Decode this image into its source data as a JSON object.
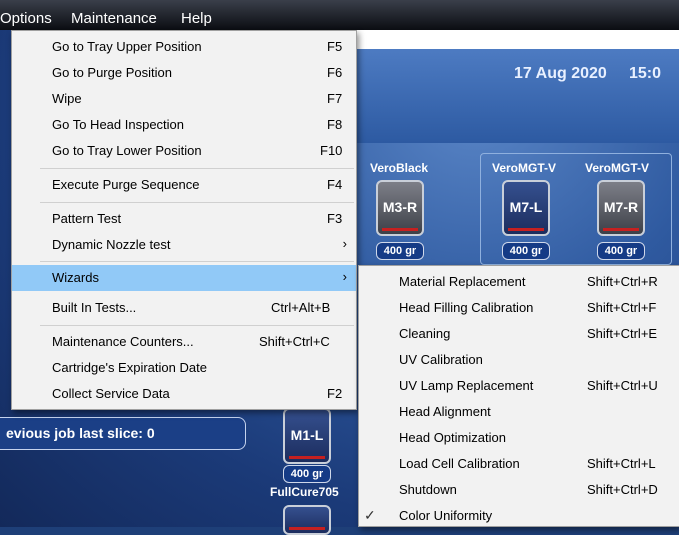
{
  "menubar": {
    "items": [
      "Options",
      "Maintenance",
      "Help"
    ]
  },
  "header": {
    "date": "17 Aug 2020",
    "time": "15:0"
  },
  "materials": {
    "labels": [
      "VeroBlack",
      "VeroMGT-V",
      "VeroMGT-V",
      "FullCure705"
    ],
    "cartridges": [
      "M3-R",
      "M7-L",
      "M7-R",
      "M1-L"
    ],
    "weights": [
      "400 gr",
      "400 gr",
      "400 gr",
      "400 gr"
    ]
  },
  "status": {
    "prev_job": "evious job last slice: 0"
  },
  "main_menu": {
    "items": [
      {
        "label": "Go to Tray Upper Position",
        "shortcut": "F5"
      },
      {
        "label": "Go to Purge Position",
        "shortcut": "F6"
      },
      {
        "label": "Wipe",
        "shortcut": "F7"
      },
      {
        "label": "Go To Head Inspection",
        "shortcut": "F8"
      },
      {
        "label": "Go to Tray Lower Position",
        "shortcut": "F10"
      },
      {
        "label": "Execute Purge Sequence",
        "shortcut": "F4"
      },
      {
        "label": "Pattern Test",
        "shortcut": "F3"
      },
      {
        "label": "Dynamic Nozzle test",
        "shortcut": ""
      },
      {
        "label": "Wizards",
        "shortcut": ""
      },
      {
        "label": "Built In Tests...",
        "shortcut": "Ctrl+Alt+B"
      },
      {
        "label": "Maintenance Counters...",
        "shortcut": "Shift+Ctrl+C"
      },
      {
        "label": "Cartridge's Expiration Date",
        "shortcut": ""
      },
      {
        "label": "Collect Service Data",
        "shortcut": "F2"
      }
    ],
    "arrow": "›"
  },
  "sub_menu": {
    "items": [
      {
        "label": "Material Replacement",
        "shortcut": "Shift+Ctrl+R"
      },
      {
        "label": "Head Filling Calibration",
        "shortcut": "Shift+Ctrl+F"
      },
      {
        "label": "Cleaning",
        "shortcut": "Shift+Ctrl+E"
      },
      {
        "label": "UV Calibration",
        "shortcut": ""
      },
      {
        "label": "UV Lamp Replacement",
        "shortcut": "Shift+Ctrl+U"
      },
      {
        "label": "Head Alignment",
        "shortcut": ""
      },
      {
        "label": "Head Optimization",
        "shortcut": ""
      },
      {
        "label": "Load Cell Calibration",
        "shortcut": "Shift+Ctrl+L"
      },
      {
        "label": "Shutdown",
        "shortcut": "Shift+Ctrl+D"
      },
      {
        "label": "Color Uniformity",
        "shortcut": ""
      }
    ],
    "checkmark": "✓",
    "checked_item": "Color Uniformity"
  },
  "colors": {
    "highlight": "#91c9f7",
    "menu_bg": "#f2f2f2",
    "app_blue": "#2f5aa0"
  }
}
